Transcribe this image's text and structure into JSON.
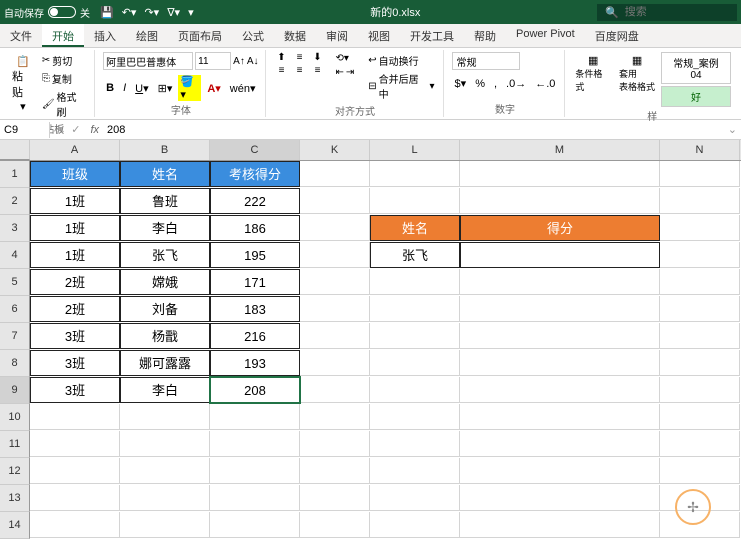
{
  "titlebar": {
    "autosave": "自动保存",
    "autosave_state": "关",
    "filename": "新的0.xlsx",
    "search_placeholder": "搜索"
  },
  "tabs": [
    "文件",
    "开始",
    "插入",
    "绘图",
    "页面布局",
    "公式",
    "数据",
    "审阅",
    "视图",
    "开发工具",
    "帮助",
    "Power Pivot",
    "百度网盘"
  ],
  "active_tab": "开始",
  "ribbon": {
    "clipboard": {
      "paste": "粘贴",
      "cut": "剪切",
      "copy": "复制",
      "format_painter": "格式刷",
      "label": "剪贴板"
    },
    "font": {
      "name": "阿里巴巴普惠体",
      "size": "11",
      "label": "字体"
    },
    "alignment": {
      "wrap": "自动换行",
      "merge": "合并后居中",
      "label": "对齐方式"
    },
    "number": {
      "format": "常规",
      "label": "数字"
    },
    "styles": {
      "cond_format": "条件格式",
      "table_format": "套用\n表格格式",
      "normal": "常规_案例04",
      "good": "好",
      "label": "样"
    }
  },
  "namebox": {
    "ref": "C9",
    "formula": "208"
  },
  "columns": [
    "A",
    "B",
    "C",
    "K",
    "L",
    "M",
    "N"
  ],
  "table1": {
    "headers": [
      "班级",
      "姓名",
      "考核得分"
    ],
    "rows": [
      [
        "1班",
        "鲁班",
        "222"
      ],
      [
        "1班",
        "李白",
        "186"
      ],
      [
        "1班",
        "张飞",
        "195"
      ],
      [
        "2班",
        "嫦娥",
        "171"
      ],
      [
        "2班",
        "刘备",
        "183"
      ],
      [
        "3班",
        "杨戬",
        "216"
      ],
      [
        "3班",
        "娜可露露",
        "193"
      ],
      [
        "3班",
        "李白",
        "208"
      ]
    ]
  },
  "table2": {
    "headers": [
      "姓名",
      "得分"
    ],
    "rows": [
      [
        "张飞",
        ""
      ]
    ]
  },
  "selected_cell": "C9",
  "chart_data": {
    "type": "table",
    "title": "考核得分",
    "columns": [
      "班级",
      "姓名",
      "考核得分"
    ],
    "rows": [
      [
        "1班",
        "鲁班",
        222
      ],
      [
        "1班",
        "李白",
        186
      ],
      [
        "1班",
        "张飞",
        195
      ],
      [
        "2班",
        "嫦娥",
        171
      ],
      [
        "2班",
        "刘备",
        183
      ],
      [
        "3班",
        "杨戬",
        216
      ],
      [
        "3班",
        "娜可露露",
        193
      ],
      [
        "3班",
        "李白",
        208
      ]
    ]
  }
}
